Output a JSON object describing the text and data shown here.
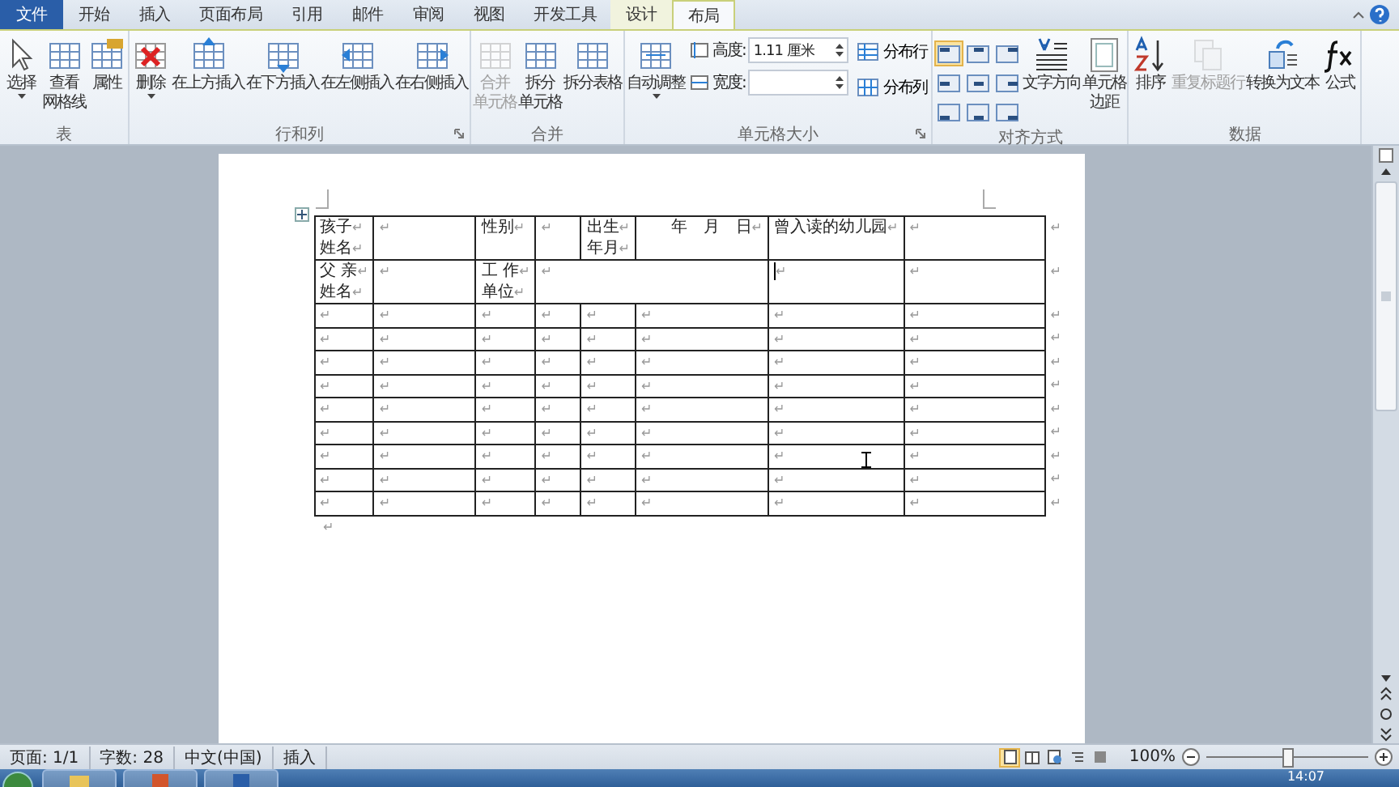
{
  "tabs": [
    {
      "label": "文件",
      "kind": "file",
      "selected": false
    },
    {
      "label": "开始",
      "kind": "normal",
      "selected": false
    },
    {
      "label": "插入",
      "kind": "normal",
      "selected": false
    },
    {
      "label": "页面布局",
      "kind": "normal",
      "selected": false
    },
    {
      "label": "引用",
      "kind": "normal",
      "selected": false
    },
    {
      "label": "邮件",
      "kind": "normal",
      "selected": false
    },
    {
      "label": "审阅",
      "kind": "normal",
      "selected": false
    },
    {
      "label": "视图",
      "kind": "normal",
      "selected": false
    },
    {
      "label": "开发工具",
      "kind": "normal",
      "selected": false
    },
    {
      "label": "设计",
      "kind": "context",
      "selected": false
    },
    {
      "label": "布局",
      "kind": "context",
      "selected": true
    }
  ],
  "ribbon_groups": [
    {
      "label": "表",
      "launcher": false,
      "items": [
        {
          "kind": "large",
          "lines": [
            "选择"
          ],
          "dropdown": true,
          "disabled": false
        },
        {
          "kind": "large",
          "lines": [
            "查看",
            "网格线"
          ],
          "dropdown": false,
          "disabled": false
        },
        {
          "kind": "large",
          "lines": [
            "属性"
          ],
          "dropdown": false,
          "disabled": false
        }
      ]
    },
    {
      "label": "行和列",
      "launcher": true,
      "items": [
        {
          "kind": "large",
          "lines": [
            "删除"
          ],
          "dropdown": true,
          "disabled": false
        },
        {
          "kind": "large",
          "lines": [
            "在上方插入"
          ],
          "dropdown": false,
          "disabled": false
        },
        {
          "kind": "large",
          "lines": [
            "在下方插入"
          ],
          "dropdown": false,
          "disabled": false
        },
        {
          "kind": "large",
          "lines": [
            "在左侧插入"
          ],
          "dropdown": false,
          "disabled": false
        },
        {
          "kind": "large",
          "lines": [
            "在右侧插入"
          ],
          "dropdown": false,
          "disabled": false
        }
      ]
    },
    {
      "label": "合并",
      "launcher": false,
      "items": [
        {
          "kind": "large",
          "lines": [
            "合并",
            "单元格"
          ],
          "dropdown": false,
          "disabled": true
        },
        {
          "kind": "large",
          "lines": [
            "拆分",
            "单元格"
          ],
          "dropdown": false,
          "disabled": false
        },
        {
          "kind": "large",
          "lines": [
            "拆分表格"
          ],
          "dropdown": false,
          "disabled": false
        }
      ]
    },
    {
      "label": "单元格大小",
      "launcher": true,
      "items": [
        {
          "kind": "large",
          "lines": [
            "自动调整"
          ],
          "dropdown": true,
          "disabled": false
        },
        {
          "kind": "fields",
          "fields": [
            {
              "label": "高度:",
              "value": "1.11 厘米"
            },
            {
              "label": "宽度:"
            }
          ]
        },
        {
          "kind": "small_stack",
          "buttons": [
            "分布行",
            "分布列"
          ]
        }
      ]
    },
    {
      "label": "对齐方式",
      "launcher": false,
      "items": [
        {
          "kind": "align_grid",
          "cells": [
            {
              "selected": true
            },
            {
              "selected": false
            },
            {
              "selected": false
            },
            {
              "selected": false
            },
            {
              "selected": false
            },
            {
              "selected": false
            },
            {
              "selected": false
            },
            {
              "selected": false
            },
            {
              "selected": false
            }
          ]
        },
        {
          "kind": "large",
          "lines": [
            "文字方向"
          ],
          "dropdown": false,
          "disabled": false
        },
        {
          "kind": "large",
          "lines": [
            "单元格",
            "边距"
          ],
          "dropdown": false,
          "disabled": false
        }
      ]
    },
    {
      "label": "数据",
      "launcher": false,
      "items": [
        {
          "kind": "large",
          "lines": [
            "排序"
          ],
          "dropdown": false,
          "disabled": false
        },
        {
          "kind": "large",
          "lines": [
            "重复标题行"
          ],
          "dropdown": false,
          "disabled": true
        },
        {
          "kind": "large",
          "lines": [
            "转换为文本"
          ],
          "dropdown": false,
          "disabled": false
        },
        {
          "kind": "large",
          "lines": [
            "公式"
          ],
          "dropdown": false,
          "disabled": false
        }
      ]
    }
  ],
  "document": {
    "para_mark": "↵",
    "table": {
      "rows": [
        [
          {
            "kind": "text",
            "paras": [
              "孩子",
              "姓名"
            ]
          },
          {
            "kind": "empty"
          },
          {
            "kind": "text",
            "paras": [
              "性别"
            ]
          },
          {
            "kind": "empty"
          },
          {
            "kind": "text",
            "paras": [
              "出生",
              "年月"
            ]
          },
          {
            "kind": "date",
            "paras": [
              "年　月　日"
            ]
          },
          {
            "kind": "text",
            "paras": [
              "曾入读的幼儿园"
            ]
          },
          {
            "kind": "empty"
          }
        ],
        [
          {
            "kind": "text",
            "paras": [
              "父 亲",
              "姓名"
            ]
          },
          {
            "kind": "empty"
          },
          {
            "kind": "text",
            "paras": [
              "工 作",
              "单位"
            ]
          },
          {
            "kind": "merged"
          },
          {
            "kind": "empty",
            "cursor": true
          },
          {
            "kind": "empty"
          }
        ],
        [
          {
            "kind": "empty"
          },
          {
            "kind": "empty"
          },
          {
            "kind": "empty"
          },
          {
            "kind": "empty"
          },
          {
            "kind": "empty"
          },
          {
            "kind": "empty"
          },
          {
            "kind": "empty"
          },
          {
            "kind": "empty"
          }
        ],
        [
          {
            "kind": "empty"
          },
          {
            "kind": "empty"
          },
          {
            "kind": "empty"
          },
          {
            "kind": "empty"
          },
          {
            "kind": "empty"
          },
          {
            "kind": "empty"
          },
          {
            "kind": "empty"
          },
          {
            "kind": "empty"
          }
        ],
        [
          {
            "kind": "empty"
          },
          {
            "kind": "empty"
          },
          {
            "kind": "empty"
          },
          {
            "kind": "empty"
          },
          {
            "kind": "empty"
          },
          {
            "kind": "empty"
          },
          {
            "kind": "empty"
          },
          {
            "kind": "empty"
          }
        ],
        [
          {
            "kind": "empty"
          },
          {
            "kind": "empty"
          },
          {
            "kind": "empty"
          },
          {
            "kind": "empty"
          },
          {
            "kind": "empty"
          },
          {
            "kind": "empty"
          },
          {
            "kind": "empty"
          },
          {
            "kind": "empty"
          }
        ],
        [
          {
            "kind": "empty"
          },
          {
            "kind": "empty"
          },
          {
            "kind": "empty"
          },
          {
            "kind": "empty"
          },
          {
            "kind": "empty"
          },
          {
            "kind": "empty"
          },
          {
            "kind": "empty"
          },
          {
            "kind": "empty"
          }
        ],
        [
          {
            "kind": "empty"
          },
          {
            "kind": "empty"
          },
          {
            "kind": "empty"
          },
          {
            "kind": "empty"
          },
          {
            "kind": "empty"
          },
          {
            "kind": "empty"
          },
          {
            "kind": "empty"
          },
          {
            "kind": "empty"
          }
        ],
        [
          {
            "kind": "empty"
          },
          {
            "kind": "empty"
          },
          {
            "kind": "empty"
          },
          {
            "kind": "empty"
          },
          {
            "kind": "empty"
          },
          {
            "kind": "empty"
          },
          {
            "kind": "empty"
          },
          {
            "kind": "empty"
          }
        ],
        [
          {
            "kind": "empty"
          },
          {
            "kind": "empty"
          },
          {
            "kind": "empty"
          },
          {
            "kind": "empty"
          },
          {
            "kind": "empty"
          },
          {
            "kind": "empty"
          },
          {
            "kind": "empty"
          },
          {
            "kind": "empty"
          }
        ],
        [
          {
            "kind": "empty"
          },
          {
            "kind": "empty"
          },
          {
            "kind": "empty"
          },
          {
            "kind": "empty"
          },
          {
            "kind": "empty"
          },
          {
            "kind": "empty"
          },
          {
            "kind": "empty"
          },
          {
            "kind": "empty"
          }
        ]
      ]
    }
  },
  "status_bar": {
    "items": [
      "页面: 1/1",
      "字数: 28",
      "中文(中国)",
      "插入"
    ],
    "zoom": "100%",
    "zoom_slider": {
      "level": 0.5
    }
  },
  "taskbar": {
    "clock": "14:07"
  }
}
